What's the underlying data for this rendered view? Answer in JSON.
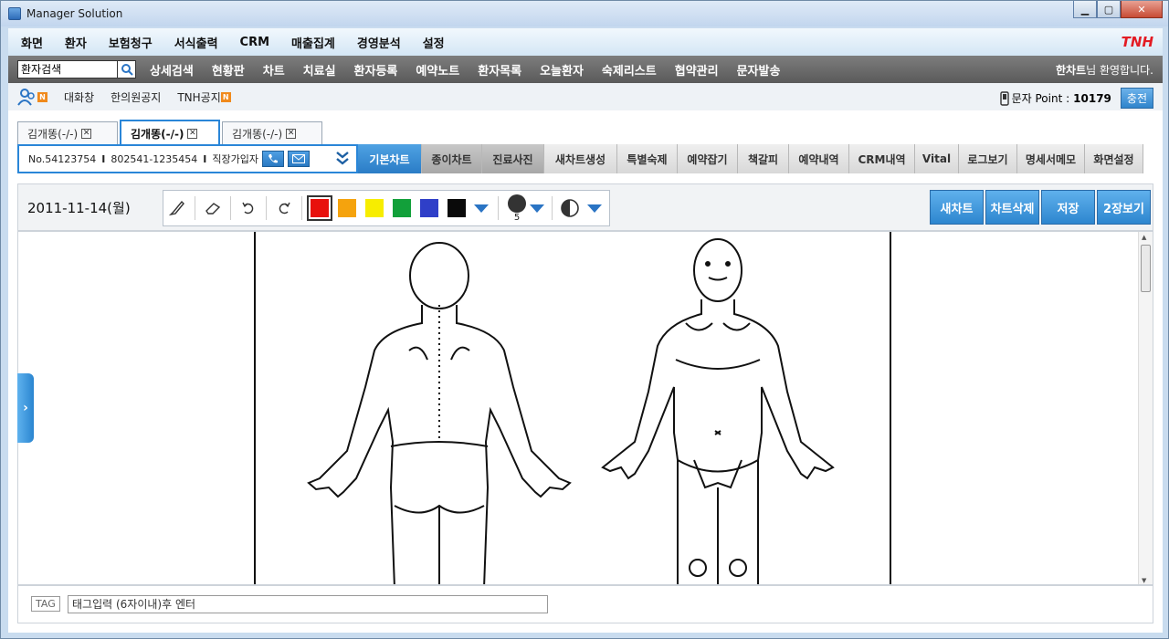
{
  "window": {
    "title": "Manager Solution",
    "minimize": "▁",
    "maximize": "▢",
    "close": "✕"
  },
  "menu": {
    "items": [
      "화면",
      "환자",
      "보험청구",
      "서식출력",
      "CRM",
      "매출집계",
      "경영분석",
      "설정"
    ],
    "brand": "TNH"
  },
  "subbar": {
    "search_value": "환자검색",
    "items": [
      "상세검색",
      "현황판",
      "차트",
      "치료실",
      "환자등록",
      "예약노트",
      "환자목록",
      "오늘환자",
      "숙제리스트",
      "협약관리",
      "문자발송"
    ],
    "welcome_name": "한차트",
    "welcome_suffix": "님 환영합니다."
  },
  "notice": {
    "badge": "N",
    "items": [
      "대화창",
      "한의원공지",
      "TNH공지"
    ],
    "sms_label": "문자 Point :",
    "sms_points": "10179",
    "charge_label": "충전"
  },
  "patient_tabs": [
    "김개똥(-/-)",
    "김개똥(-/-)",
    "김개똥(-/-)"
  ],
  "patient_info": {
    "number": "No.54123754",
    "sep": "I",
    "rrn": "802541-1235454",
    "insurance": "직장가입자",
    "expand": "⌄⌄"
  },
  "chart_tabs": [
    "기본차트",
    "종이차트",
    "진료사진",
    "새차트생성",
    "특별숙제",
    "예약잡기",
    "책갈피",
    "예약내역",
    "CRM내역",
    "Vital",
    "로그보기",
    "명세서메모",
    "화면설정"
  ],
  "drawbar": {
    "date": "2011-11-14(월)",
    "colors": [
      "#e8100c",
      "#f5a30d",
      "#f7ed00",
      "#12a03a",
      "#2f3fc8",
      "#0a0a0a"
    ],
    "stroke_size": "5",
    "actions": [
      "새차트",
      "차트삭제",
      "저장",
      "2장보기"
    ]
  },
  "tag": {
    "label": "TAG",
    "placeholder": "태그입력 (6자이내)후 엔터"
  },
  "side_toggle": "›"
}
